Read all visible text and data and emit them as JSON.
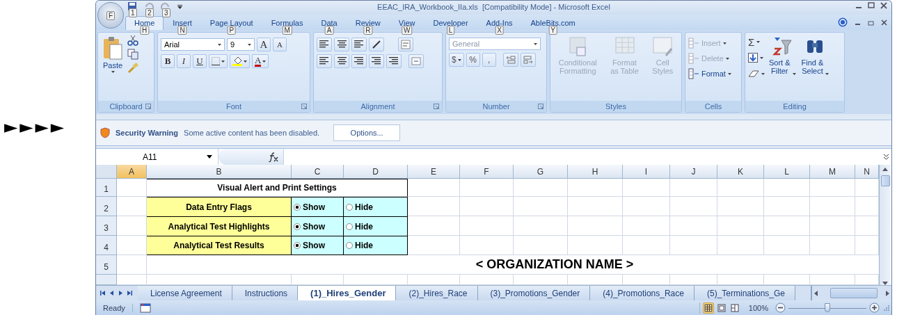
{
  "pointer_arrows": "►►►►",
  "window": {
    "title": "EEAC_IRA_Workbook_IIa.xls  [Compatibility Mode] - Microsoft Excel",
    "office_keytip": "F",
    "quick_access_keytips": [
      "1",
      "2",
      "3"
    ]
  },
  "ribbon_tabs": [
    {
      "label": "Home",
      "keytip": "H",
      "selected": true
    },
    {
      "label": "Insert",
      "keytip": "N",
      "selected": false
    },
    {
      "label": "Page Layout",
      "keytip": "P",
      "selected": false
    },
    {
      "label": "Formulas",
      "keytip": "M",
      "selected": false
    },
    {
      "label": "Data",
      "keytip": "A",
      "selected": false
    },
    {
      "label": "Review",
      "keytip": "R",
      "selected": false
    },
    {
      "label": "View",
      "keytip": "W",
      "selected": false
    },
    {
      "label": "Developer",
      "keytip": "L",
      "selected": false
    },
    {
      "label": "Add-Ins",
      "keytip": "X",
      "selected": false
    },
    {
      "label": "AbleBits.com",
      "keytip": "Y",
      "selected": false
    }
  ],
  "ribbon": {
    "groups": [
      {
        "kind": "clipboard",
        "label": "Clipboard",
        "launcher": true,
        "paste": "Paste"
      },
      {
        "kind": "font",
        "label": "Font",
        "launcher": true,
        "font_name": "Arial",
        "font_size": "9",
        "grow": "A",
        "shrink": "A",
        "buttons": [
          "B",
          "I",
          "U"
        ],
        "font_color": "A"
      },
      {
        "kind": "alignment",
        "label": "Alignment",
        "launcher": true
      },
      {
        "kind": "number",
        "label": "Number",
        "launcher": true,
        "format": "General",
        "buttons": [
          "$",
          "%",
          ","
        ]
      },
      {
        "kind": "styles",
        "label": "Styles",
        "items": [
          {
            "label": "Conditional\nFormatting",
            "disabled": true
          },
          {
            "label": "Format\nas Table",
            "disabled": true
          },
          {
            "label": "Cell\nStyles",
            "disabled": true
          }
        ]
      },
      {
        "kind": "cells",
        "label": "Cells",
        "items": [
          {
            "label": "Insert",
            "disabled": true
          },
          {
            "label": "Delete",
            "disabled": true
          },
          {
            "label": "Format",
            "disabled": false
          }
        ]
      },
      {
        "kind": "editing",
        "label": "Editing",
        "sigma": "Σ",
        "items": [
          {
            "label": "Sort &\nFilter"
          },
          {
            "label": "Find &\nSelect"
          }
        ]
      }
    ]
  },
  "security_bar": {
    "title": "Security Warning",
    "message": "Some active content has been disabled.",
    "button": "Options..."
  },
  "formula_bar": {
    "name_box": "A11"
  },
  "sheet": {
    "columns": [
      {
        "label": "A",
        "selected": true
      },
      {
        "label": "B",
        "selected": false
      },
      {
        "label": "C",
        "selected": false
      },
      {
        "label": "D",
        "selected": false
      },
      {
        "label": "E",
        "selected": false
      },
      {
        "label": "F",
        "selected": false
      },
      {
        "label": "G",
        "selected": false
      },
      {
        "label": "H",
        "selected": false
      },
      {
        "label": "I",
        "selected": false
      },
      {
        "label": "J",
        "selected": false
      },
      {
        "label": "K",
        "selected": false
      },
      {
        "label": "L",
        "selected": false
      },
      {
        "label": "M",
        "selected": false
      },
      {
        "label": "N",
        "selected": false
      }
    ],
    "rows": [
      {
        "header": "1",
        "kind": "title",
        "text": "Visual Alert and Print Settings"
      },
      {
        "header": "2",
        "kind": "setting",
        "label": "Data Entry Flags",
        "options": [
          {
            "label": "Show",
            "selected": true
          },
          {
            "label": "Hide",
            "selected": false
          }
        ]
      },
      {
        "header": "3",
        "kind": "setting",
        "label": "Analytical Test Highlights",
        "options": [
          {
            "label": "Show",
            "selected": true
          },
          {
            "label": "Hide",
            "selected": false
          }
        ]
      },
      {
        "header": "4",
        "kind": "setting",
        "label": "Analytical Test Results",
        "options": [
          {
            "label": "Show",
            "selected": true
          },
          {
            "label": "Hide",
            "selected": false
          }
        ]
      },
      {
        "header": "5",
        "kind": "heading",
        "text": "< ORGANIZATION NAME >"
      }
    ]
  },
  "sheet_tabs": [
    {
      "label": "License Agreement",
      "selected": false
    },
    {
      "label": "Instructions",
      "selected": false
    },
    {
      "label": "(1)_Hires_Gender",
      "selected": true
    },
    {
      "label": "(2)_Hires_Race",
      "selected": false
    },
    {
      "label": "(3)_Promotions_Gender",
      "selected": false
    },
    {
      "label": "(4)_Promotions_Race",
      "selected": false
    },
    {
      "label": "(5)_Terminations_Ge",
      "selected": false
    }
  ],
  "status_bar": {
    "status": "Ready",
    "views": [
      {
        "kind": "normal",
        "selected": true
      },
      {
        "kind": "page_layout",
        "selected": false
      },
      {
        "kind": "page_break",
        "selected": false
      }
    ],
    "zoom": "100%",
    "zoom_slider": {
      "level": 0.5
    }
  }
}
